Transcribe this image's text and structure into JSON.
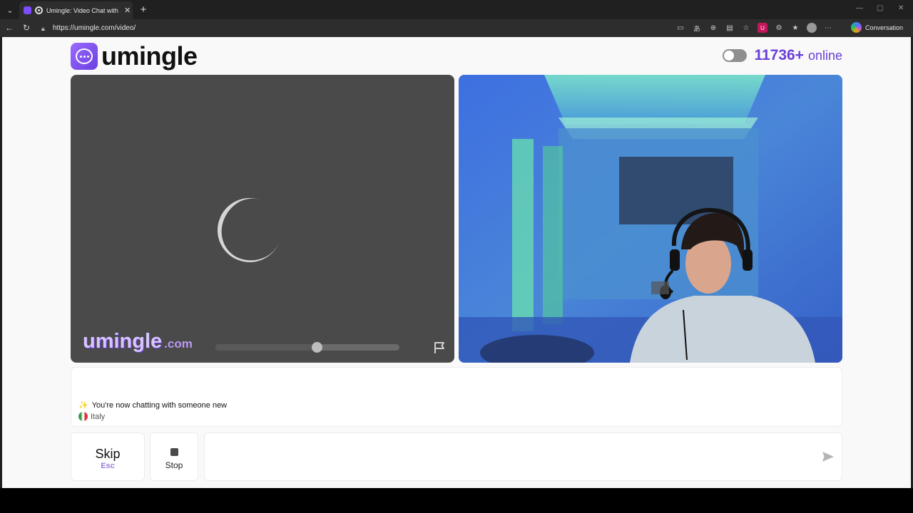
{
  "browser": {
    "tab_title": "Umingle: Video Chat with Strangers",
    "tab_close": "✕",
    "new_tab": "+",
    "url": "https://umingle.com/video/",
    "copilot_label": "Conversation"
  },
  "header": {
    "logo_text": "umingle",
    "online_count": "11736+",
    "online_label": "online",
    "toggle_state": "off"
  },
  "video": {
    "watermark_main": "umingle",
    "watermark_suffix": ".com",
    "volume_level": 0.55
  },
  "chat": {
    "system_message": "You're now chatting with someone new",
    "country": "Italy"
  },
  "controls": {
    "skip_label": "Skip",
    "skip_key": "Esc",
    "stop_label": "Stop",
    "message_placeholder": ""
  },
  "colors": {
    "accent": "#6a40d8",
    "watermark": "#d9c4ff"
  }
}
